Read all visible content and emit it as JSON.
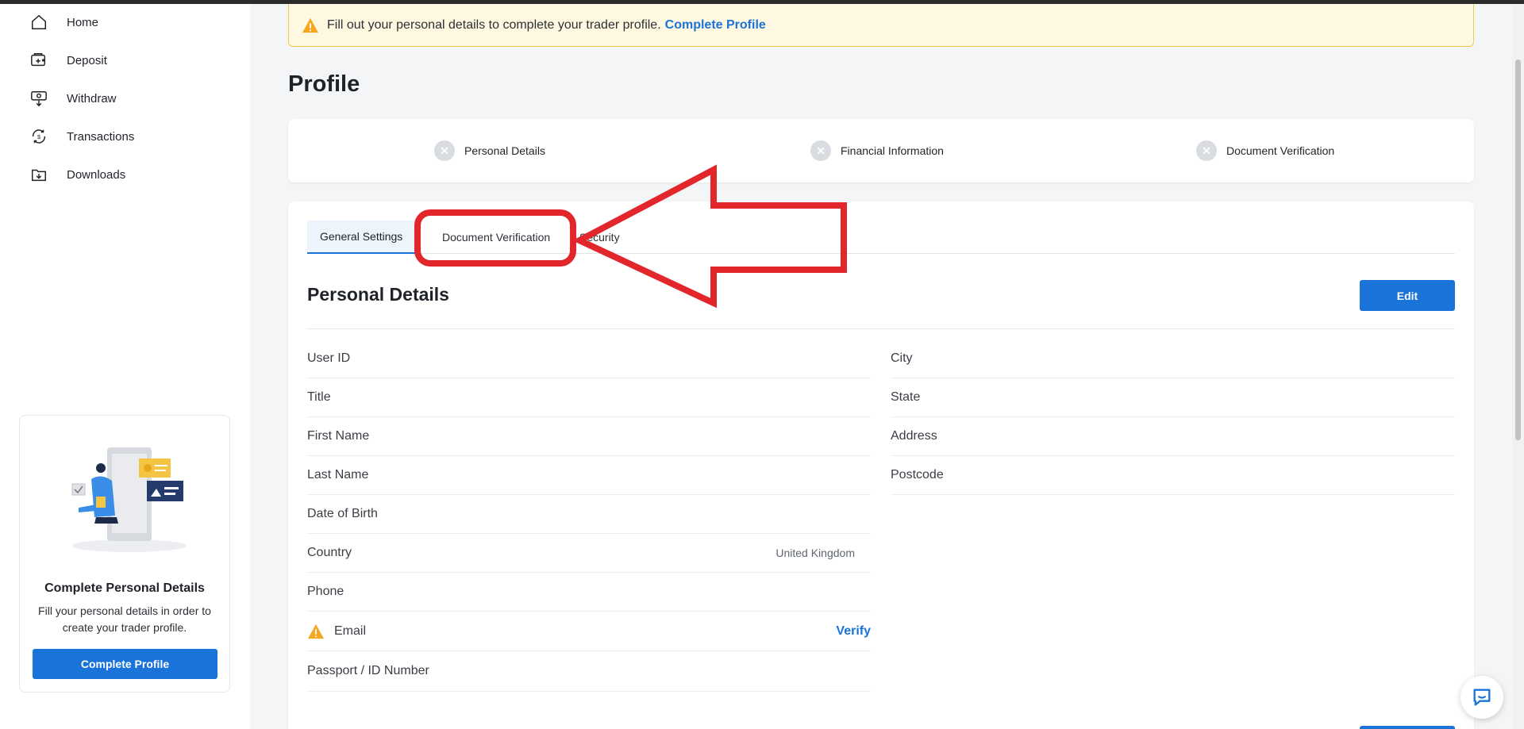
{
  "sidebar": {
    "nav": [
      {
        "label": "Home",
        "icon": "home-icon"
      },
      {
        "label": "Deposit",
        "icon": "deposit-icon"
      },
      {
        "label": "Withdraw",
        "icon": "withdraw-icon"
      },
      {
        "label": "Transactions",
        "icon": "transactions-icon"
      },
      {
        "label": "Downloads",
        "icon": "downloads-icon"
      }
    ],
    "promo": {
      "title": "Complete Personal Details",
      "text": "Fill your personal details in order to create your trader profile.",
      "button": "Complete Profile"
    }
  },
  "alert": {
    "text": "Fill out your personal details to complete your trader profile.",
    "link": "Complete Profile"
  },
  "page_title": "Profile",
  "steps": [
    "Personal Details",
    "Financial Information",
    "Document Verification"
  ],
  "tabs": [
    "General Settings",
    "Document Verification",
    "Security"
  ],
  "section": {
    "title": "Personal Details",
    "edit_label": "Edit"
  },
  "fields_left": [
    "User ID",
    "Title",
    "First Name",
    "Last Name",
    "Date of Birth",
    "Country",
    "Phone",
    "Email",
    "Passport / ID Number"
  ],
  "fields_right": [
    "City",
    "State",
    "Address",
    "Postcode"
  ],
  "country_value": "United Kingdom",
  "email_verify": "Verify",
  "colors": {
    "accent": "#1a73d9",
    "warning": "#f5a623",
    "annotation": "#e3262b"
  }
}
